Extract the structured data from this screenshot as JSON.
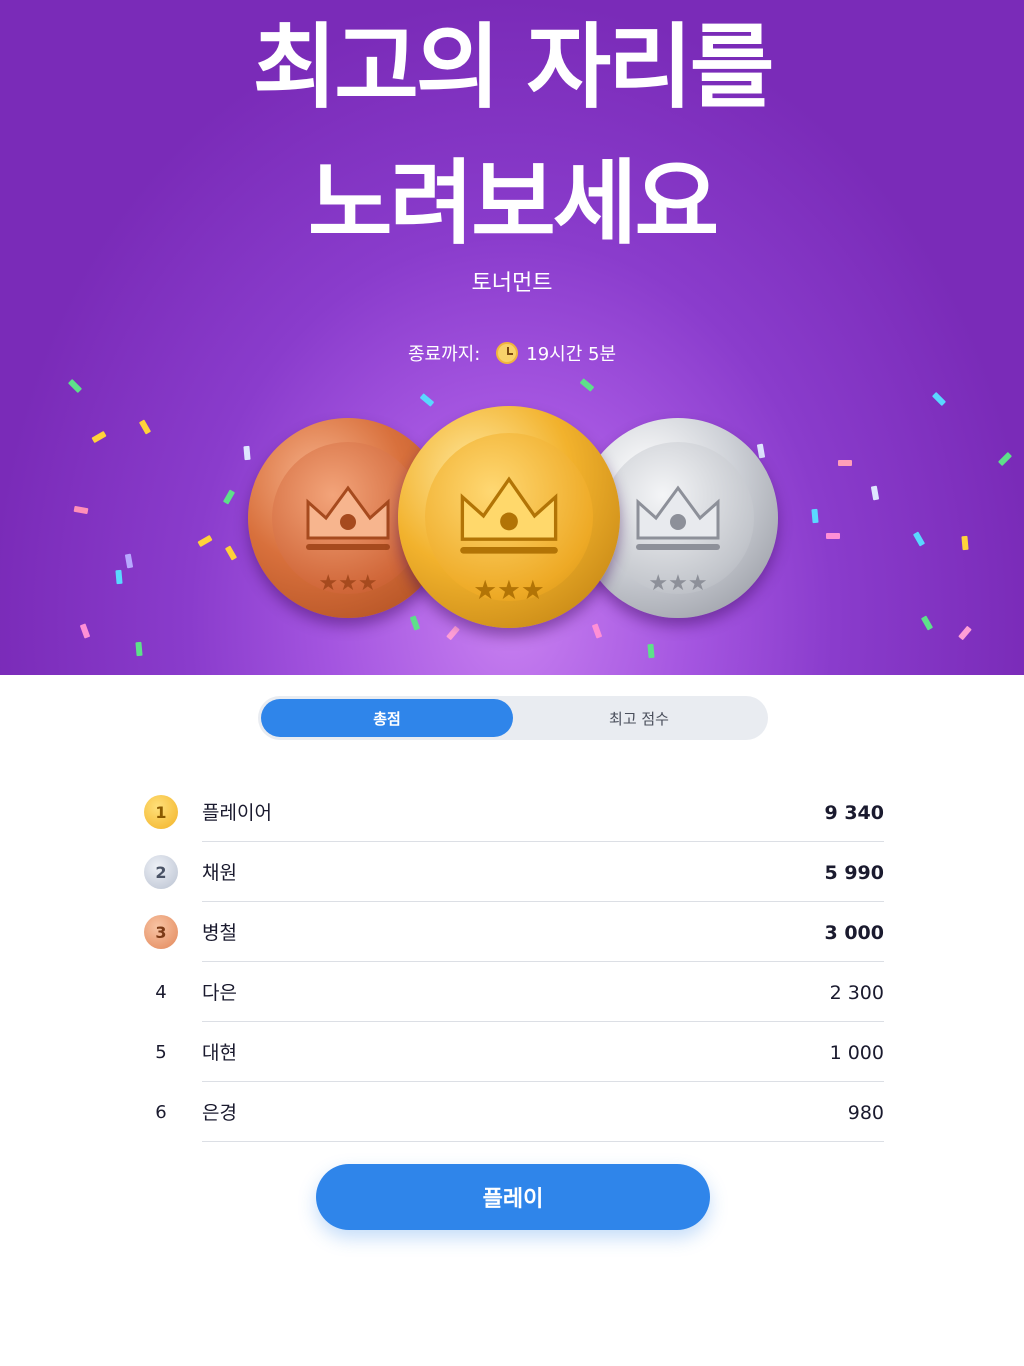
{
  "hero": {
    "headline_line1": "최고의 자리를",
    "headline_line2": "노려보세요",
    "subtitle": "토너먼트",
    "timer_label": "종료까지:",
    "timer_icon": "clock-icon",
    "timer_value": "19시간 5분",
    "background_color": "#8a3ccc"
  },
  "coins": [
    {
      "kind": "bronze",
      "icon": "crown-icon"
    },
    {
      "kind": "gold",
      "icon": "crown-icon"
    },
    {
      "kind": "silver",
      "icon": "crown-icon"
    }
  ],
  "tabs": [
    {
      "label": "총점",
      "active": true
    },
    {
      "label": "최고 점수",
      "active": false
    }
  ],
  "leaderboard": [
    {
      "rank": "1",
      "name": "플레이어",
      "score": "9 340",
      "medal": "gold"
    },
    {
      "rank": "2",
      "name": "채원",
      "score": "5 990",
      "medal": "silver"
    },
    {
      "rank": "3",
      "name": "병철",
      "score": "3 000",
      "medal": "bronze"
    },
    {
      "rank": "4",
      "name": "다은",
      "score": "2 300",
      "medal": ""
    },
    {
      "rank": "5",
      "name": "대현",
      "score": "1 000",
      "medal": ""
    },
    {
      "rank": "6",
      "name": "은경",
      "score": "980",
      "medal": ""
    }
  ],
  "play_button": {
    "label": "플레이",
    "color": "#2f85ea"
  }
}
